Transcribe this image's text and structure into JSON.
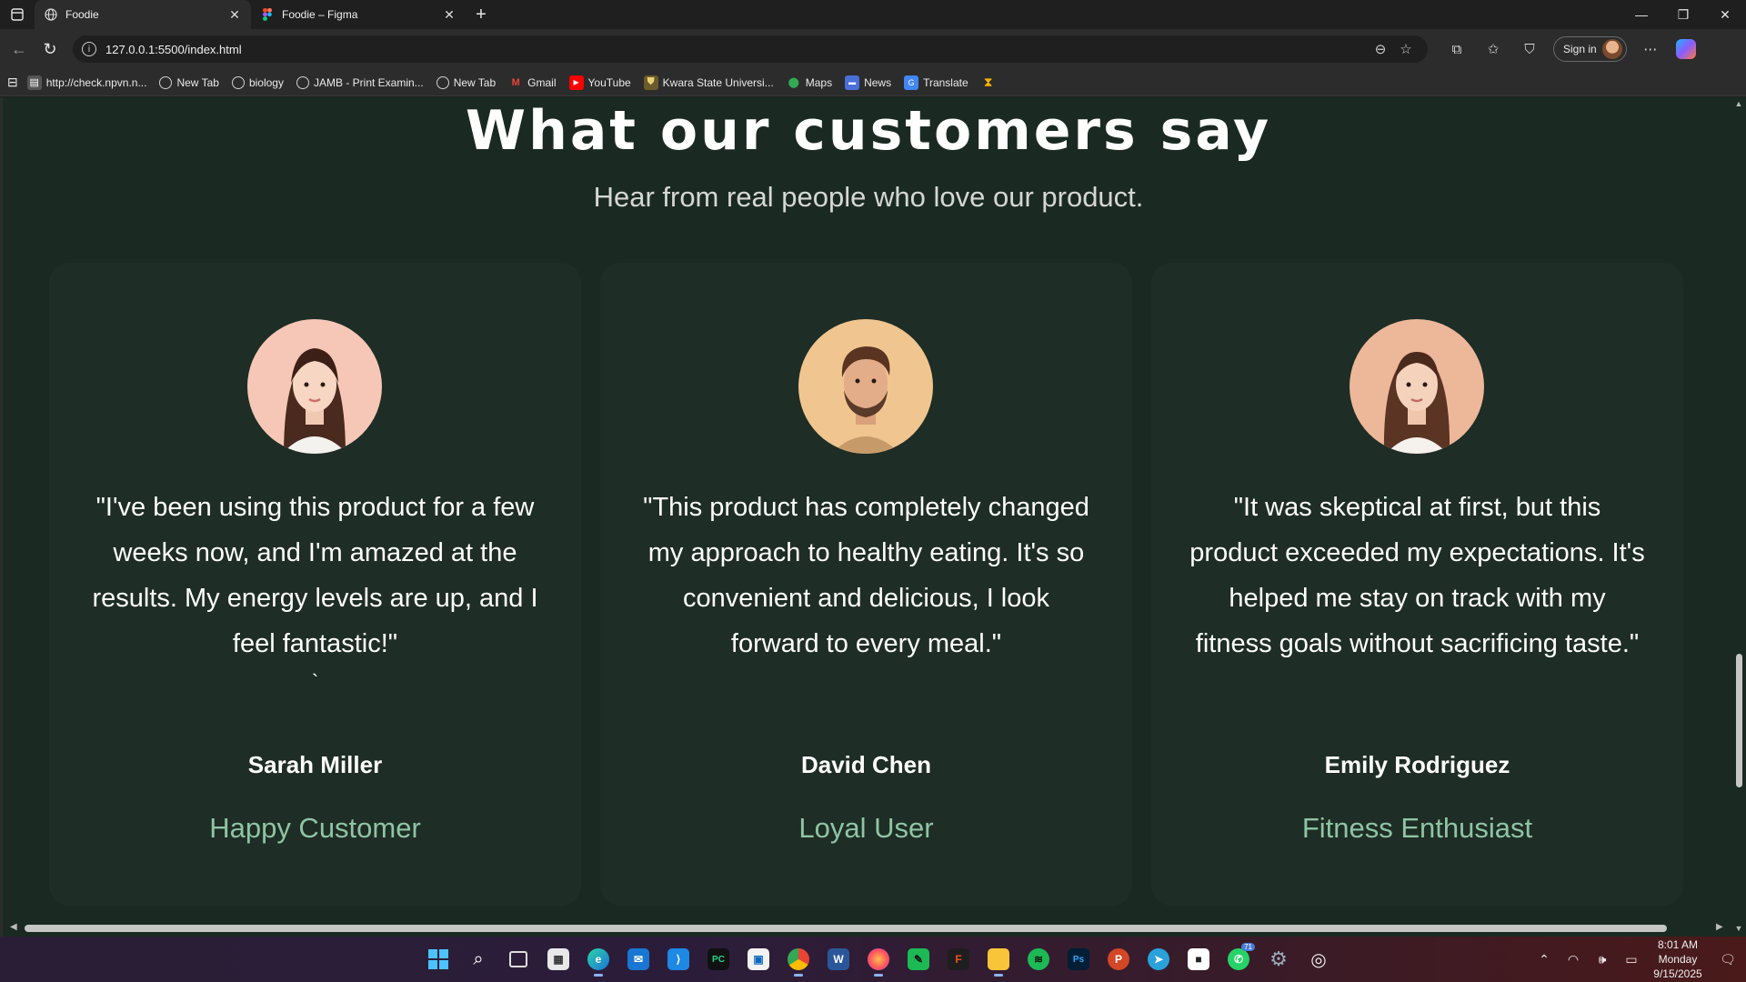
{
  "browser": {
    "tabs": [
      {
        "title": "Foodie",
        "active": true
      },
      {
        "title": "Foodie – Figma",
        "active": false
      }
    ],
    "url": "127.0.0.1:5500/index.html",
    "sign_in": "Sign in",
    "bookmarks": [
      {
        "label": "http://check.npvn.n...",
        "icon": "page-icon"
      },
      {
        "label": "New Tab",
        "icon": "globe-icon"
      },
      {
        "label": "biology",
        "icon": "globe-icon"
      },
      {
        "label": "JAMB - Print Examin...",
        "icon": "globe-icon"
      },
      {
        "label": "New Tab",
        "icon": "globe-icon"
      },
      {
        "label": "Gmail",
        "icon": "gmail-icon"
      },
      {
        "label": "YouTube",
        "icon": "youtube-icon"
      },
      {
        "label": "Kwara State Universi...",
        "icon": "shield-crest-icon"
      },
      {
        "label": "Maps",
        "icon": "maps-pin-icon"
      },
      {
        "label": "News",
        "icon": "news-icon"
      },
      {
        "label": "Translate",
        "icon": "translate-icon"
      }
    ]
  },
  "page": {
    "title": "What our customers say",
    "subtitle": "Hear from real people who love our product.",
    "testimonials": [
      {
        "quote": "\"I've been using this product for a few weeks now, and I'm amazed at the results. My energy levels are up, and I feel fantastic!\"",
        "extra": "`",
        "name": "Sarah Miller",
        "role": "Happy Customer"
      },
      {
        "quote": "\"This product has completely changed my approach to healthy eating. It's so convenient and delicious, I look forward to every meal.\"",
        "extra": "",
        "name": "David Chen",
        "role": "Loyal User"
      },
      {
        "quote": "\"It was skeptical at first, but this product exceeded my expectations. It's helped me stay on track with my fitness goals without sacrificing taste.\"",
        "extra": "",
        "name": "Emily Rodriguez",
        "role": "Fitness Enthusiast"
      }
    ]
  },
  "taskbar": {
    "time": "8:01 AM",
    "day": "Monday",
    "date": "9/15/2025",
    "whatsapp_badge": "71"
  },
  "colors": {
    "page_bg": "#1a2a22",
    "card_bg": "#1e2d25",
    "accent_role": "#8fc4a4"
  }
}
